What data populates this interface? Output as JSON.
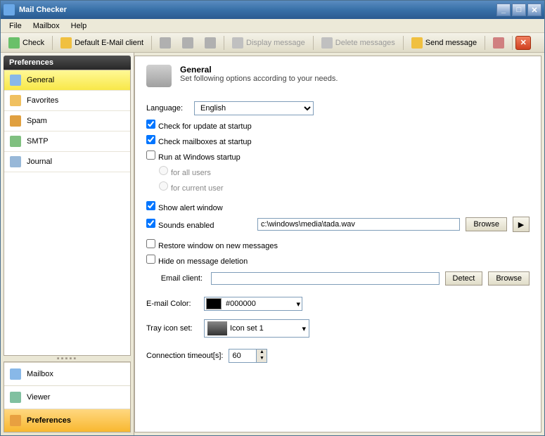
{
  "window": {
    "title": "Mail Checker"
  },
  "menu": {
    "file": "File",
    "mailbox": "Mailbox",
    "help": "Help"
  },
  "toolbar": {
    "check": "Check",
    "default_client": "Default E-Mail client",
    "display_msg": "Display message",
    "delete_msgs": "Delete messages",
    "send_msg": "Send message"
  },
  "sidebar": {
    "header": "Preferences",
    "items": [
      {
        "label": "General"
      },
      {
        "label": "Favorites"
      },
      {
        "label": "Spam"
      },
      {
        "label": "SMTP"
      },
      {
        "label": "Journal"
      }
    ],
    "bottom": [
      {
        "label": "Mailbox"
      },
      {
        "label": "Viewer"
      },
      {
        "label": "Preferences"
      }
    ]
  },
  "main": {
    "title": "General",
    "subtitle": "Set following options according to your needs.",
    "language_label": "Language:",
    "language_value": "English",
    "check_update": "Check for update at startup",
    "check_mailboxes": "Check mailboxes at startup",
    "run_windows": "Run at Windows startup",
    "for_all": "for all users",
    "for_current": "for current user",
    "show_alert": "Show alert window",
    "sounds_enabled": "Sounds enabled",
    "sound_path": "c:\\windows\\media\\tada.wav",
    "browse": "Browse",
    "restore_window": "Restore window  on new messages",
    "hide_on_delete": "Hide on message deletion",
    "email_client_label": "Email client:",
    "email_client_value": "",
    "detect": "Detect",
    "email_color_label": "E-mail Color:",
    "color_value": "#000000",
    "tray_icon_label": "Tray icon set:",
    "tray_icon_value": "Icon set 1",
    "timeout_label": "Connection timeout[s]:",
    "timeout_value": "60"
  }
}
